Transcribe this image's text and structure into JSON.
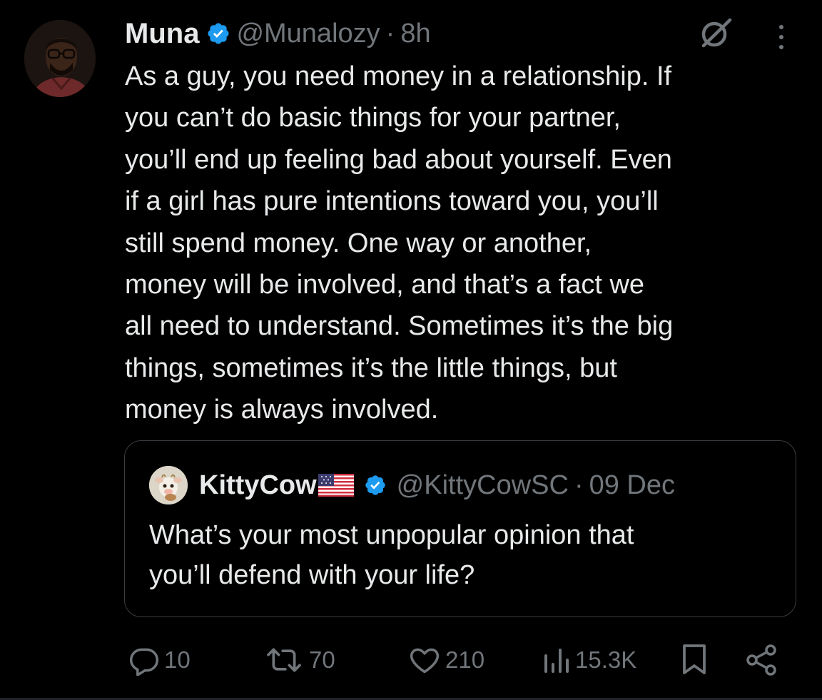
{
  "tweet": {
    "author_name": "Muna",
    "author_handle": "@Munalozy",
    "separator": "·",
    "time": "8h",
    "text": "As a guy, you need money in a relationship. If\nyou can’t do basic things for your partner,\nyou’ll end up feeling bad about yourself. Even\nif a girl has pure intentions toward you, you’ll\nstill spend money. One way or another,\nmoney will be involved, and that’s a fact we\nall need to understand. Sometimes it’s the big\nthings, sometimes it’s the little things, but\nmoney is always involved."
  },
  "quoted": {
    "author_name": "KittyCow",
    "author_handle": "@KittyCowSC",
    "separator": "·",
    "date": "09 Dec",
    "text": "What’s your most unpopular opinion that\nyou’ll defend with your life?"
  },
  "actions": {
    "replies": "10",
    "reposts": "70",
    "likes": "210",
    "views": "15.3K"
  },
  "icons": {
    "verified": "verified-badge-icon",
    "grok": "grok-icon",
    "more": "more-options-icon",
    "reply": "reply-icon",
    "repost": "repost-icon",
    "like": "heart-icon",
    "views": "views-chart-icon",
    "bookmark": "bookmark-icon",
    "share": "share-icon"
  },
  "colors": {
    "background": "#000000",
    "text_primary": "#e7e9ea",
    "text_secondary": "#71767b",
    "verified_blue": "#1d9bf0",
    "border": "#3a3d41"
  }
}
